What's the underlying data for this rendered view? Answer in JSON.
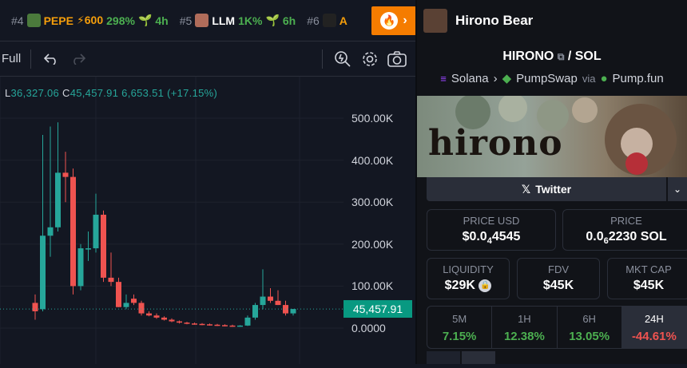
{
  "ticker": [
    {
      "rank": "#4",
      "symbol": "PEPE",
      "boost": "⚡600",
      "pct": "298%",
      "age": "4h",
      "thumb_color": "#4b7a3c",
      "symbol_color": "#f59e0b"
    },
    {
      "rank": "#5",
      "symbol": "LLM",
      "boost": "",
      "pct": "1K%",
      "age": "6h",
      "thumb_color": "#b06c5a",
      "symbol_color": "#ffffff"
    },
    {
      "rank": "#6",
      "symbol": "A",
      "boost": "",
      "pct": "",
      "age": "",
      "thumb_color": "#222222",
      "symbol_color": "#f59e0b"
    }
  ],
  "toolbar": {
    "full": "Full"
  },
  "ohlc": {
    "l_label": "L",
    "l_value": "36,327.06",
    "c_label": "C",
    "c_value": "45,457.91",
    "change": "6,653.51 (+17.15%)"
  },
  "axis": {
    "labels": [
      "500.00K",
      "400.00K",
      "300.00K",
      "200.00K",
      "100.00K",
      "0.0000"
    ],
    "current": "45,457.91"
  },
  "chart_data": {
    "type": "candlestick",
    "colors": {
      "up": "#26a69a",
      "down": "#ef5350"
    },
    "ylim": [
      0,
      500000
    ],
    "candles": [
      {
        "o": 60000,
        "h": 80000,
        "l": 20000,
        "c": 40000
      },
      {
        "o": 45000,
        "h": 460000,
        "l": 40000,
        "c": 220000
      },
      {
        "o": 220000,
        "h": 480000,
        "l": 170000,
        "c": 240000
      },
      {
        "o": 240000,
        "h": 490000,
        "l": 230000,
        "c": 370000
      },
      {
        "o": 370000,
        "h": 420000,
        "l": 300000,
        "c": 360000
      },
      {
        "o": 360000,
        "h": 380000,
        "l": 80000,
        "c": 100000
      },
      {
        "o": 100000,
        "h": 200000,
        "l": 90000,
        "c": 190000
      },
      {
        "o": 190000,
        "h": 230000,
        "l": 160000,
        "c": 190000
      },
      {
        "o": 190000,
        "h": 320000,
        "l": 180000,
        "c": 270000
      },
      {
        "o": 270000,
        "h": 280000,
        "l": 110000,
        "c": 120000
      },
      {
        "o": 120000,
        "h": 180000,
        "l": 100000,
        "c": 110000
      },
      {
        "o": 110000,
        "h": 120000,
        "l": 50000,
        "c": 50000
      },
      {
        "o": 50000,
        "h": 80000,
        "l": 45000,
        "c": 60000
      },
      {
        "o": 70000,
        "h": 80000,
        "l": 55000,
        "c": 60000
      },
      {
        "o": 60000,
        "h": 65000,
        "l": 30000,
        "c": 35000
      },
      {
        "o": 35000,
        "h": 40000,
        "l": 28000,
        "c": 30000
      },
      {
        "o": 30000,
        "h": 35000,
        "l": 22000,
        "c": 25000
      },
      {
        "o": 25000,
        "h": 28000,
        "l": 18000,
        "c": 20000
      },
      {
        "o": 20000,
        "h": 23000,
        "l": 14000,
        "c": 16000
      },
      {
        "o": 16000,
        "h": 18000,
        "l": 11000,
        "c": 13000
      },
      {
        "o": 13000,
        "h": 15000,
        "l": 9000,
        "c": 11000
      },
      {
        "o": 11000,
        "h": 13000,
        "l": 8000,
        "c": 10000
      },
      {
        "o": 10000,
        "h": 12000,
        "l": 7000,
        "c": 9000
      },
      {
        "o": 9000,
        "h": 11000,
        "l": 6000,
        "c": 8000
      },
      {
        "o": 8000,
        "h": 10000,
        "l": 5000,
        "c": 7000
      },
      {
        "o": 7000,
        "h": 9000,
        "l": 4000,
        "c": 6000
      },
      {
        "o": 6000,
        "h": 8000,
        "l": 3000,
        "c": 5000
      },
      {
        "o": 5000,
        "h": 7000,
        "l": 3000,
        "c": 6000
      },
      {
        "o": 6000,
        "h": 30000,
        "l": 5000,
        "c": 25000
      },
      {
        "o": 25000,
        "h": 60000,
        "l": 20000,
        "c": 55000
      },
      {
        "o": 55000,
        "h": 140000,
        "l": 45000,
        "c": 75000
      },
      {
        "o": 75000,
        "h": 95000,
        "l": 60000,
        "c": 65000
      },
      {
        "o": 65000,
        "h": 90000,
        "l": 55000,
        "c": 55000
      },
      {
        "o": 55000,
        "h": 65000,
        "l": 30000,
        "c": 35000
      },
      {
        "o": 35000,
        "h": 45000,
        "l": 30000,
        "c": 45458
      }
    ]
  },
  "panel": {
    "name": "Hirono Bear",
    "base": "HIRONO",
    "quote": "SOL",
    "chain": "Solana",
    "dex": "PumpSwap",
    "via_label": "via",
    "via": "Pump.fun",
    "banner_text": "hirono",
    "twitter": "Twitter",
    "price_usd": {
      "label": "PRICE USD",
      "pre": "$0.0",
      "sub": "4",
      "post": "4545"
    },
    "price_sol": {
      "label": "PRICE",
      "pre": "0.0",
      "sub": "6",
      "post": "2230 SOL"
    },
    "liquidity": {
      "label": "LIQUIDITY",
      "value": "$29K"
    },
    "fdv": {
      "label": "FDV",
      "value": "$45K"
    },
    "mcap": {
      "label": "MKT CAP",
      "value": "$45K"
    },
    "timeframes": [
      {
        "label": "5M",
        "value": "7.15%",
        "color": "#4caf50"
      },
      {
        "label": "1H",
        "value": "12.38%",
        "color": "#4caf50"
      },
      {
        "label": "6H",
        "value": "13.05%",
        "color": "#4caf50"
      },
      {
        "label": "24H",
        "value": "-44.61%",
        "color": "#ef5350"
      }
    ]
  }
}
